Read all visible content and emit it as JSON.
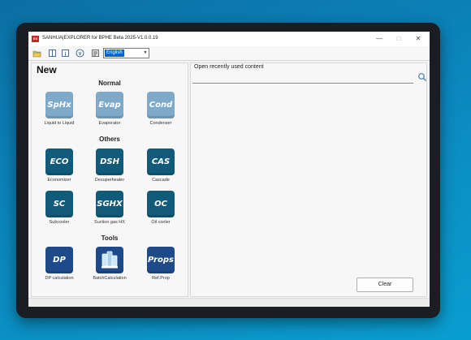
{
  "window": {
    "app_icon_text": "EX",
    "title": "SANHUA|EXPLORER for BPHE Beta 2025-V1.0.0.19",
    "minimize_glyph": "—",
    "maximize_glyph": "□",
    "close_glyph": "✕"
  },
  "toolbar": {
    "icons": [
      "folder-icon",
      "book-icon",
      "info-icon",
      "version-icon",
      "settings-icon"
    ],
    "language_value": "English",
    "language_arrow": "▼"
  },
  "left_panel": {
    "heading": "New",
    "sections": [
      {
        "title": "Normal",
        "items": [
          {
            "icon_text": "SpHx",
            "label": "Liquid to Liquid",
            "style": "light"
          },
          {
            "icon_text": "Evap",
            "label": "Evaporator",
            "style": "light"
          },
          {
            "icon_text": "Cond",
            "label": "Condenser",
            "style": "light"
          }
        ]
      },
      {
        "title": "Others",
        "items": [
          {
            "icon_text": "ECO",
            "label": "Economizer",
            "style": "teal"
          },
          {
            "icon_text": "DSH",
            "label": "Desuperheater",
            "style": "teal"
          },
          {
            "icon_text": "CAS",
            "label": "Cascade",
            "style": "teal"
          },
          {
            "icon_text": "SC",
            "label": "Subcooler",
            "style": "teal"
          },
          {
            "icon_text": "SGHX",
            "label": "Suction gas HX",
            "style": "teal"
          },
          {
            "icon_text": "OC",
            "label": "Oil cooler",
            "style": "teal"
          }
        ]
      },
      {
        "title": "Tools",
        "items": [
          {
            "icon_text": "DP",
            "label": "DP calculation",
            "style": "navy"
          },
          {
            "icon_text": "",
            "label": "BatchCalculation",
            "style": "navy"
          },
          {
            "icon_text": "Props",
            "label": "Ref.Prop",
            "style": "navy"
          }
        ]
      }
    ]
  },
  "right_panel": {
    "heading": "Open recently used content",
    "clear_label": "Clear"
  }
}
